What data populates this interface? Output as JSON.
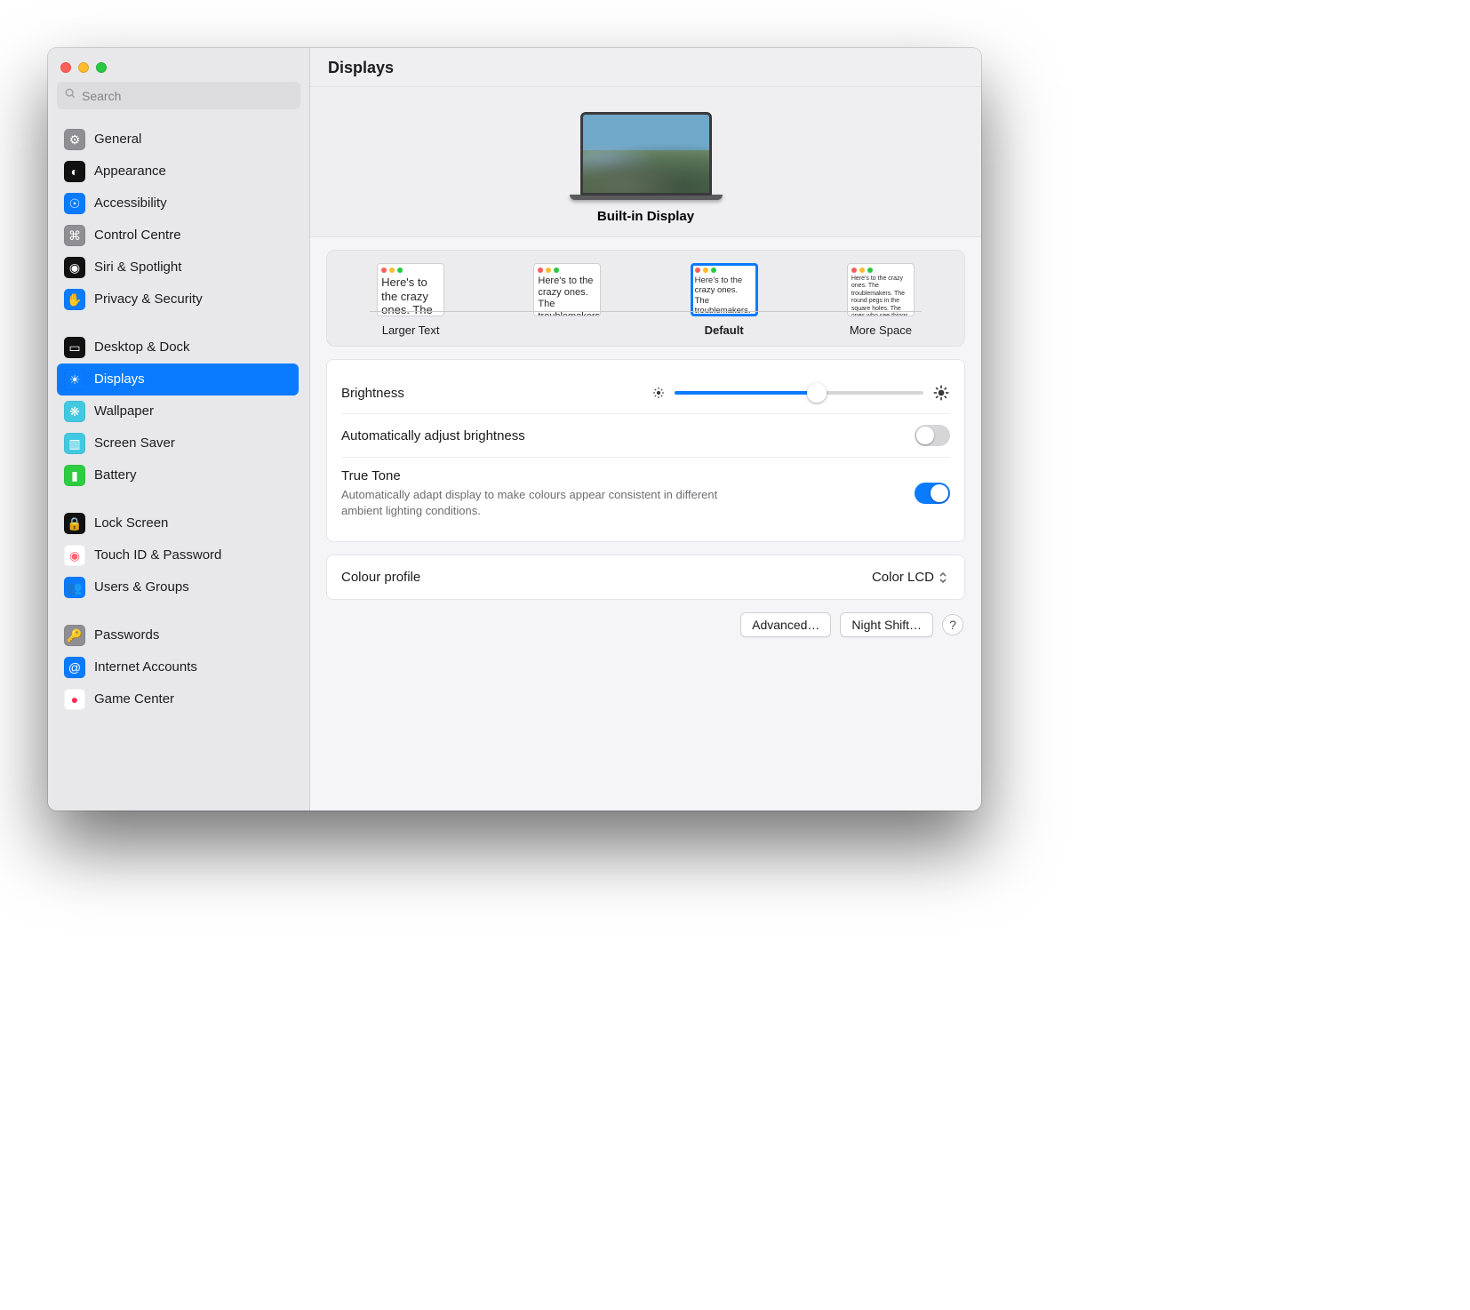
{
  "window": {
    "title": "Displays"
  },
  "search": {
    "placeholder": "Search"
  },
  "sidebar": {
    "groups": [
      [
        {
          "id": "general",
          "label": "General",
          "color": "#8e8e93",
          "glyph": "⚙︎"
        },
        {
          "id": "appearance",
          "label": "Appearance",
          "color": "#111111",
          "glyph": "◐"
        },
        {
          "id": "accessibility",
          "label": "Accessibility",
          "color": "#0a7bff",
          "glyph": "☉"
        },
        {
          "id": "control-centre",
          "label": "Control Centre",
          "color": "#8e8e93",
          "glyph": "⌘"
        },
        {
          "id": "siri-spotlight",
          "label": "Siri & Spotlight",
          "color": "#111111",
          "glyph": "◉"
        },
        {
          "id": "privacy-security",
          "label": "Privacy & Security",
          "color": "#0a7bff",
          "glyph": "✋"
        }
      ],
      [
        {
          "id": "desktop-dock",
          "label": "Desktop & Dock",
          "color": "#111111",
          "glyph": "▭"
        },
        {
          "id": "displays",
          "label": "Displays",
          "color": "#0a7bff",
          "glyph": "☀︎",
          "selected": true
        },
        {
          "id": "wallpaper",
          "label": "Wallpaper",
          "color": "#42c8e0",
          "glyph": "❋"
        },
        {
          "id": "screen-saver",
          "label": "Screen Saver",
          "color": "#42c8e0",
          "glyph": "▥"
        },
        {
          "id": "battery",
          "label": "Battery",
          "color": "#2ecc40",
          "glyph": "▮"
        }
      ],
      [
        {
          "id": "lock-screen",
          "label": "Lock Screen",
          "color": "#111111",
          "glyph": "🔒"
        },
        {
          "id": "touch-id",
          "label": "Touch ID & Password",
          "color": "#ffffff",
          "glyph": "◉",
          "fg": "#ff6670"
        },
        {
          "id": "users-groups",
          "label": "Users & Groups",
          "color": "#0a7bff",
          "glyph": "👥"
        }
      ],
      [
        {
          "id": "passwords",
          "label": "Passwords",
          "color": "#8e8e93",
          "glyph": "🔑"
        },
        {
          "id": "internet-accounts",
          "label": "Internet Accounts",
          "color": "#0a7bff",
          "glyph": "@"
        },
        {
          "id": "game-center",
          "label": "Game Center",
          "color": "#ffffff",
          "glyph": "●",
          "fg": "#ff2d55"
        }
      ]
    ]
  },
  "display": {
    "name": "Built-in Display"
  },
  "resolution": {
    "thumb_text": "Here's to the crazy ones. The troublemakers. The round pegs in the square holes. The ones who see things differently. And they have no respect for the rules.",
    "options": [
      {
        "id": "larger-text",
        "label": "Larger Text",
        "size": "lg"
      },
      {
        "id": "mid-1",
        "label": "",
        "size": "md"
      },
      {
        "id": "default",
        "label": "Default",
        "size": "sm",
        "selected": true
      },
      {
        "id": "more-space",
        "label": "More Space",
        "size": "xs"
      }
    ]
  },
  "settings": {
    "brightness_label": "Brightness",
    "brightness_percent": 57,
    "auto_brightness_label": "Automatically adjust brightness",
    "auto_brightness_on": false,
    "true_tone_label": "True Tone",
    "true_tone_desc": "Automatically adapt display to make colours appear consistent in different ambient lighting conditions.",
    "true_tone_on": true,
    "colour_profile_label": "Colour profile",
    "colour_profile_value": "Color LCD"
  },
  "footer": {
    "advanced_label": "Advanced…",
    "night_shift_label": "Night Shift…"
  }
}
